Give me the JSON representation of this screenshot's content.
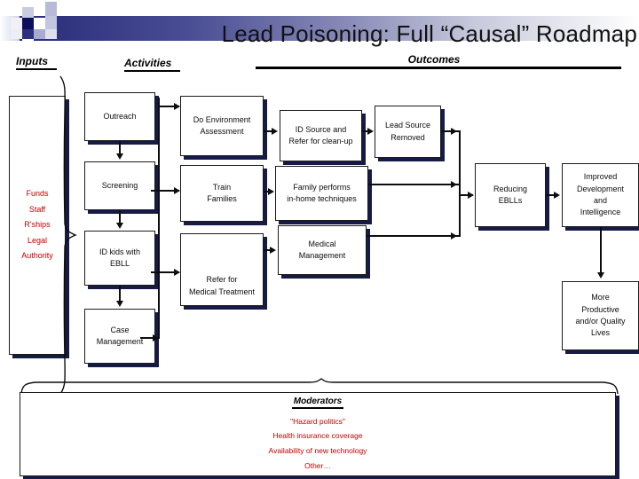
{
  "slide": {
    "title": "Lead Poisoning: Full “Causal” Roadmap",
    "columns": {
      "inputs": "Inputs",
      "activities": "Activities",
      "outcomes": "Outcomes"
    }
  },
  "inputs_box": {
    "items": [
      "Funds",
      "Staff",
      "R'ships",
      "Legal",
      "Authority"
    ]
  },
  "activities": {
    "outreach": "Outreach",
    "screening": "Screening",
    "id_kids_l1": "ID kids with",
    "id_kids_l2": "EBLL",
    "case_l1": "Case",
    "case_l2": "Management",
    "do_env_l1": "Do Environment",
    "do_env_l2": "Assessment",
    "train_l1": "Train",
    "train_l2": "Families",
    "refer_l1": "Refer for",
    "refer_l2": "Medical Treatment"
  },
  "outcomes": {
    "id_source_l1": "ID Source and",
    "id_source_l2": "Refer for clean-up",
    "lead_removed_l1": "Lead Source",
    "lead_removed_l2": "Removed",
    "family_l1": "Family performs",
    "family_l2": "in-home techniques",
    "medical_l1": "Medical",
    "medical_l2": "Management",
    "reducing_l1": "Reducing",
    "reducing_l2": "EBLLs",
    "improved_l1": "Improved",
    "improved_l2": "Development",
    "improved_l3": "and",
    "improved_l4": "Intelligence",
    "productive_l1": "More",
    "productive_l2": "Productive",
    "productive_l3": "and/or Quality",
    "productive_l4": "Lives"
  },
  "moderators": {
    "title": "Moderators",
    "items": [
      "\"Hazard politics\"",
      "Health insurance coverage",
      "Availability of new technology",
      "Other…"
    ]
  },
  "colors": {
    "accent_navy": "#161a46",
    "band_navy": "#2b2f7a",
    "red_text": "#c00000",
    "line": "#0d0d0d"
  }
}
